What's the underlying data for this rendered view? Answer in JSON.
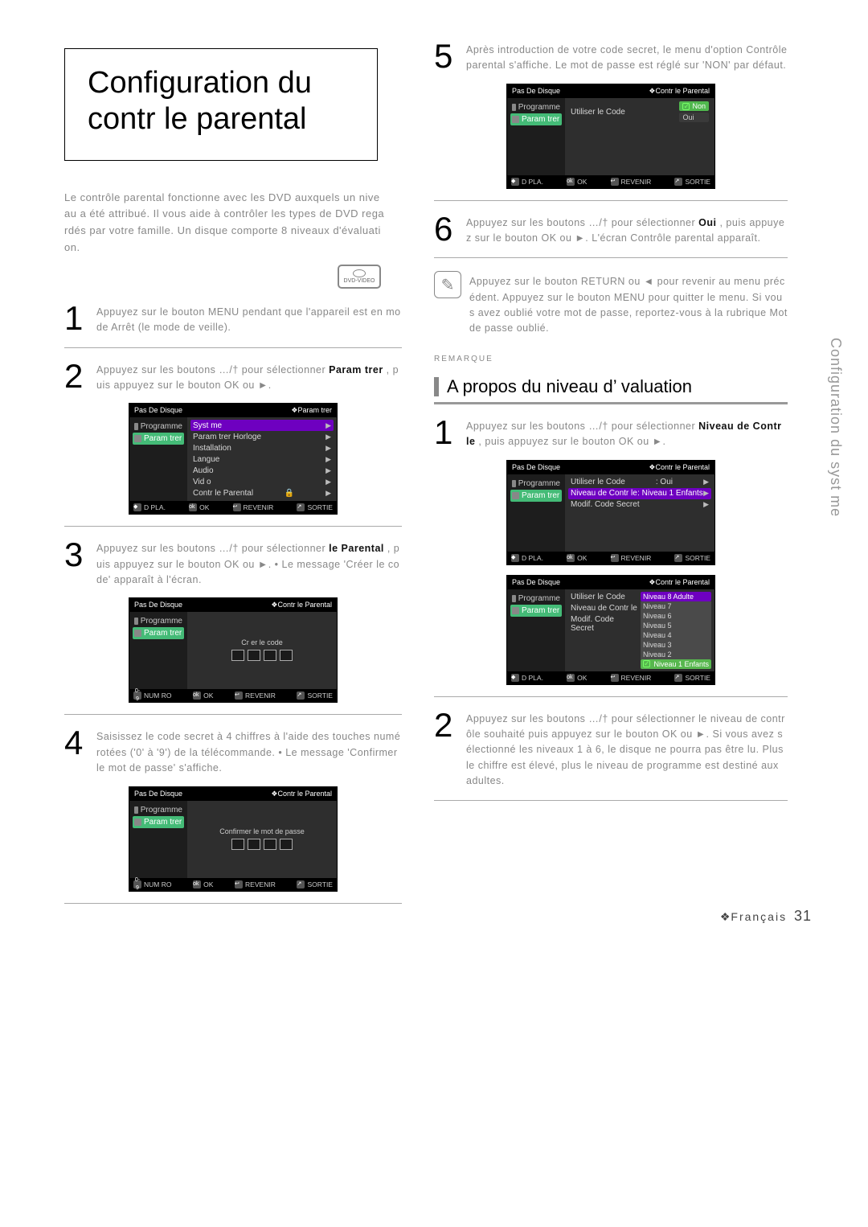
{
  "vtab": "Configuration du syst me",
  "title": "Configuration du contr le parental",
  "intro_noise": "Le contrôle parental fonctionne avec les DVD auxquels un niveau a été attribué. Il vous aide à contrôler les types de DVD regardés par votre famille. Un disque comporte 8 niveaux d'évaluation.",
  "dvd_label": "DVD-VIDEO",
  "steps_left": [
    {
      "n": "1",
      "txt": "Appuyez sur le bouton MENU pendant que l'appareil est en mode Arrêt (le mode de veille).",
      "emph": ""
    },
    {
      "n": "2",
      "txt_a": "Appuyez sur les boutons …/† pour sélectionner ",
      "emph": "Param trer",
      "txt_b": ", puis appuyez sur le bouton OK ou ►."
    },
    {
      "n": "3",
      "txt_a": "Appuyez sur les boutons …/† pour sélectionner ",
      "emph": "le Parental",
      "txt_b": ", puis appuyez sur le bouton OK ou ►.  • Le message 'Créer le code' apparaît à l'écran."
    },
    {
      "n": "4",
      "txt": "Saisissez le code secret à 4 chiffres à l'aide des touches numérotées ('0' à '9') de la télécommande.  • Le message 'Confirmer le mot de passe' s'affiche."
    }
  ],
  "steps_right_top": [
    {
      "n": "5",
      "txt": "Après introduction de votre code secret, le menu d'option Contrôle parental s'affiche. Le mot de passe est réglé sur 'NON' par défaut."
    },
    {
      "n": "6",
      "txt_a": "Appuyez sur les boutons …/† pour sélectionner ",
      "emph": "Oui",
      "txt_b": ", puis appuyez sur le bouton OK ou ►. L'écran Contrôle parental apparaît."
    }
  ],
  "note_text": "Appuyez sur le bouton RETURN ou ◄ pour revenir au menu précédent. Appuyez sur le bouton MENU pour quitter le menu. Si vous avez oublié votre mot de passe, reportez-vous à la rubrique Mot de passe oublié.",
  "section_title": "A propos du niveau d’   valuation",
  "steps_right_bottom": [
    {
      "n": "1",
      "txt_a": "Appuyez sur les boutons …/† pour sélectionner ",
      "emph": "Niveau de Contr   le",
      "txt_b": ", puis appuyez sur le bouton OK ou ►."
    },
    {
      "n": "2",
      "txt": "Appuyez sur les boutons …/† pour sélectionner le niveau de contrôle souhaité puis appuyez sur le bouton OK ou ►. Si vous avez sélectionné les niveaux 1 à 6, le disque ne pourra pas être lu. Plus le chiffre est élevé, plus le niveau de programme est destiné aux adultes."
    }
  ],
  "osd_labels": {
    "nodisk": "Pas De Disque",
    "breadcrumb_param": "❖Param    trer",
    "breadcrumb_parental": "❖Contr    le Parental",
    "side_prog": "Programme",
    "side_param": "Param   trer",
    "menu2": [
      "Syst   me",
      "Param   trer Horloge",
      "Installation",
      "Langue",
      "Audio",
      "Vid   o",
      "Contr   le Parental"
    ],
    "create_code": "Cr   er le code",
    "confirm_code": "Confirmer le mot de passe",
    "use_code": "Utiliser le Code",
    "non": "Non",
    "oui": "Oui",
    "nivctrl": "Niveau de Contr   le",
    "nivctrl_val": ": Niveau 1 Enfants",
    "modif": "Modif. Code Secret",
    "oui_val": ": Oui",
    "levels": [
      "Niveau 8 Adulte",
      "Niveau 7",
      "Niveau 6",
      "Niveau 5",
      "Niveau 4",
      "Niveau 3",
      "Niveau 2",
      "Niveau 1 Enfants"
    ]
  },
  "foot": {
    "depl": "D   PLA.",
    "ok": "OK",
    "rev": "REVENIR",
    "sort": "SORTIE",
    "num": "NUM   RO"
  },
  "page_label": "Français",
  "page_num": "31"
}
